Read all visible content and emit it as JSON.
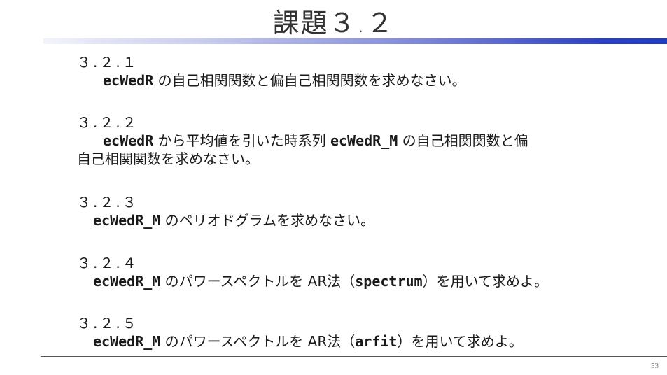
{
  "title": "課題３.２",
  "sections": [
    {
      "number": "３.２.１",
      "var1": "ecWedR",
      "text1": " の自己相関関数と偏自己相関関数を求めなさい。"
    },
    {
      "number": "３.２.２",
      "var1": "ecWedR",
      "text1": " から平均値を引いた時系列 ",
      "var2": "ecWedR_M",
      "text2": " の自己相関関数と偏",
      "text3": "自己相関関数を求めなさい。"
    },
    {
      "number": "３.２.３",
      "var1": "ecWedR_M",
      "text1": " のペリオドグラムを求めなさい。"
    },
    {
      "number": "３.２.４",
      "var1": "ecWedR_M",
      "text1": " のパワースペクトルを AR法（",
      "var2": "spectrum",
      "text2": "）を用いて求めよ。"
    },
    {
      "number": "３.２.５",
      "var1": "ecWedR_M",
      "text1": " のパワースペクトルを AR法（",
      "var2": "arfit",
      "text2": "）を用いて求めよ。"
    }
  ],
  "page_number": "53"
}
